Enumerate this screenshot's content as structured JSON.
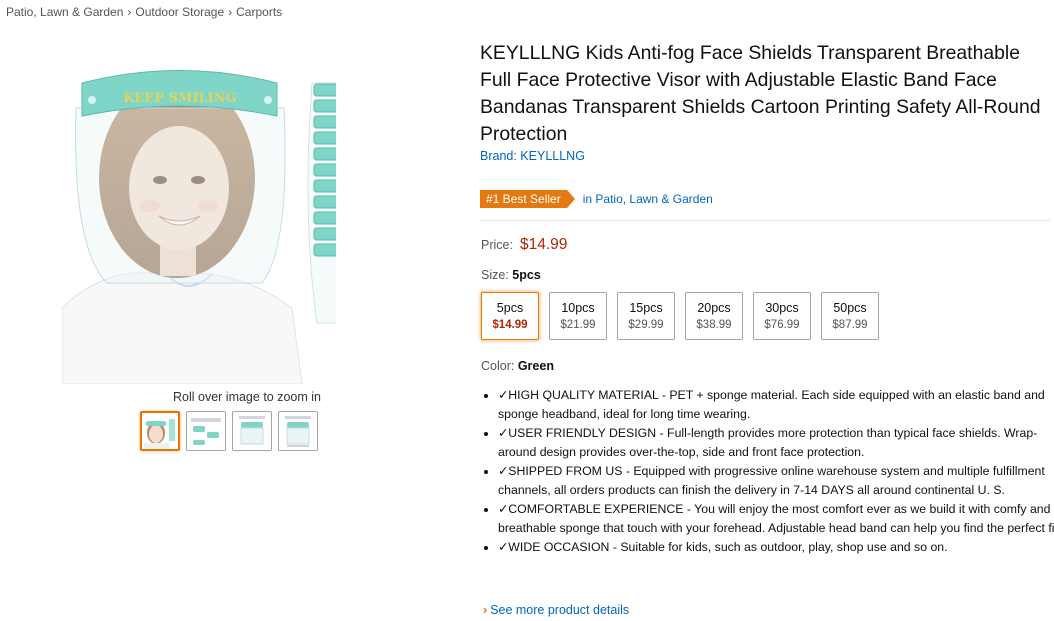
{
  "breadcrumb": [
    "Patio, Lawn & Garden",
    "Outdoor Storage",
    "Carports"
  ],
  "product": {
    "title": "KEYLLLNG Kids Anti-fog Face Shields Transparent Breathable Full Face Protective Visor with Adjustable Elastic Band Face Bandanas Transparent Shields Cartoon Printing Safety All-Round Protection",
    "brand": "Brand: KEYLLLNG",
    "visor_text": "KEEP SMILING",
    "stack_text": "KEEP SMILING"
  },
  "gallery": {
    "zoom_hint": "Roll over image to zoom in",
    "thumbnail_count": 4
  },
  "badge": {
    "label": "#1 Best Seller",
    "category": "in Patio, Lawn & Garden",
    "color": "#e47911"
  },
  "price": {
    "label": "Price:",
    "value": "$14.99",
    "color": "#b12704"
  },
  "size": {
    "label": "Size:",
    "selected": "5pcs",
    "options": [
      {
        "size": "5pcs",
        "price": "$14.99"
      },
      {
        "size": "10pcs",
        "price": "$21.99"
      },
      {
        "size": "15pcs",
        "price": "$29.99"
      },
      {
        "size": "20pcs",
        "price": "$38.99"
      },
      {
        "size": "30pcs",
        "price": "$76.99"
      },
      {
        "size": "50pcs",
        "price": "$87.99"
      }
    ]
  },
  "color": {
    "label": "Color:",
    "selected": "Green"
  },
  "bullets": [
    "✓HIGH QUALITY MATERIAL - PET + sponge material. Each side equipped with an elastic band and sponge headband, ideal for long time wearing.",
    "✓USER FRIENDLY DESIGN - Full-length provides more protection than typical face shields. Wrap-around design provides over-the-top, side and front face protection.",
    "✓SHIPPED FROM US - Equipped with progressive online warehouse system and multiple fulfillment channels, all orders products can finish the delivery in 7-14 DAYS all around continental U. S.",
    "✓COMFORTABLE EXPERIENCE - You will enjoy the most comfort ever as we build it with comfy and breathable sponge that touch with your forehead. Adjustable head band can help you find the perfect fit.",
    "✓WIDE OCCASION - Suitable for kids, such as outdoor, play, shop use and so on."
  ],
  "see_more": "See more product details",
  "colors": {
    "link": "#0066c0",
    "accent": "#e77600",
    "visor_band": "#7fd6c8"
  }
}
